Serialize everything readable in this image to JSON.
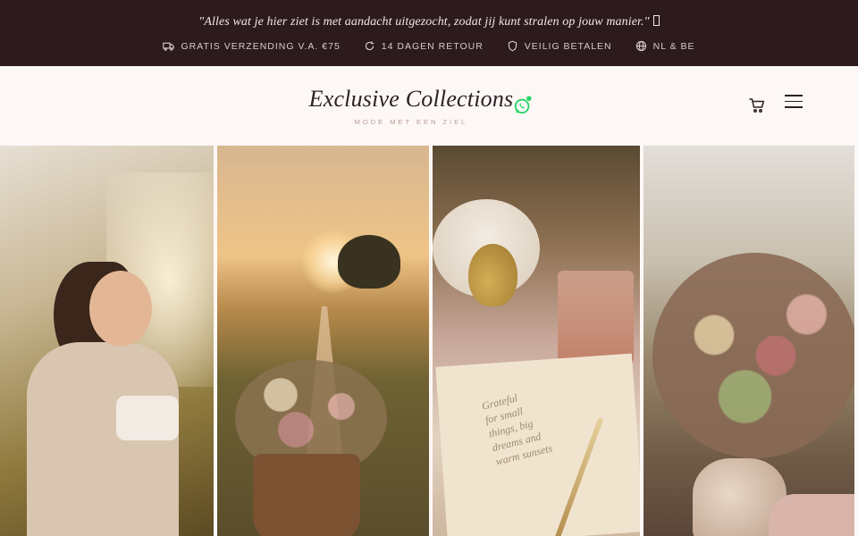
{
  "announcement": {
    "quote": "\"Alles wat je hier ziet is met aandacht uitgezocht, zodat jij kunt stralen op jouw manier.\"",
    "usps": [
      {
        "icon": "truck-icon",
        "label": "Gratis verzending v.a. €75"
      },
      {
        "icon": "return-icon",
        "label": "14 dagen retour"
      },
      {
        "icon": "shield-icon",
        "label": "Veilig betalen"
      },
      {
        "icon": "globe-icon",
        "label": "NL & BE"
      }
    ]
  },
  "header": {
    "brand_name": "Exclusive Collections",
    "tagline": "Mode met een ziel",
    "whatsapp_icon": "whatsapp-icon",
    "cart_icon": "cart-icon",
    "menu_icon": "hamburger-menu-icon"
  },
  "gallery": {
    "panels": [
      {
        "name": "woman-in-field-image"
      },
      {
        "name": "sunset-path-image"
      },
      {
        "name": "pears-and-notebook-image",
        "note_text": [
          "Grateful",
          "for small",
          "things, big",
          "dreams and",
          "warm sunsets"
        ]
      },
      {
        "name": "flower-vase-image"
      }
    ]
  },
  "colors": {
    "topbar": "#2c1a1e",
    "whatsapp_green": "#25d366",
    "brand_text": "#2a1f22",
    "tagline": "#b89a92"
  }
}
